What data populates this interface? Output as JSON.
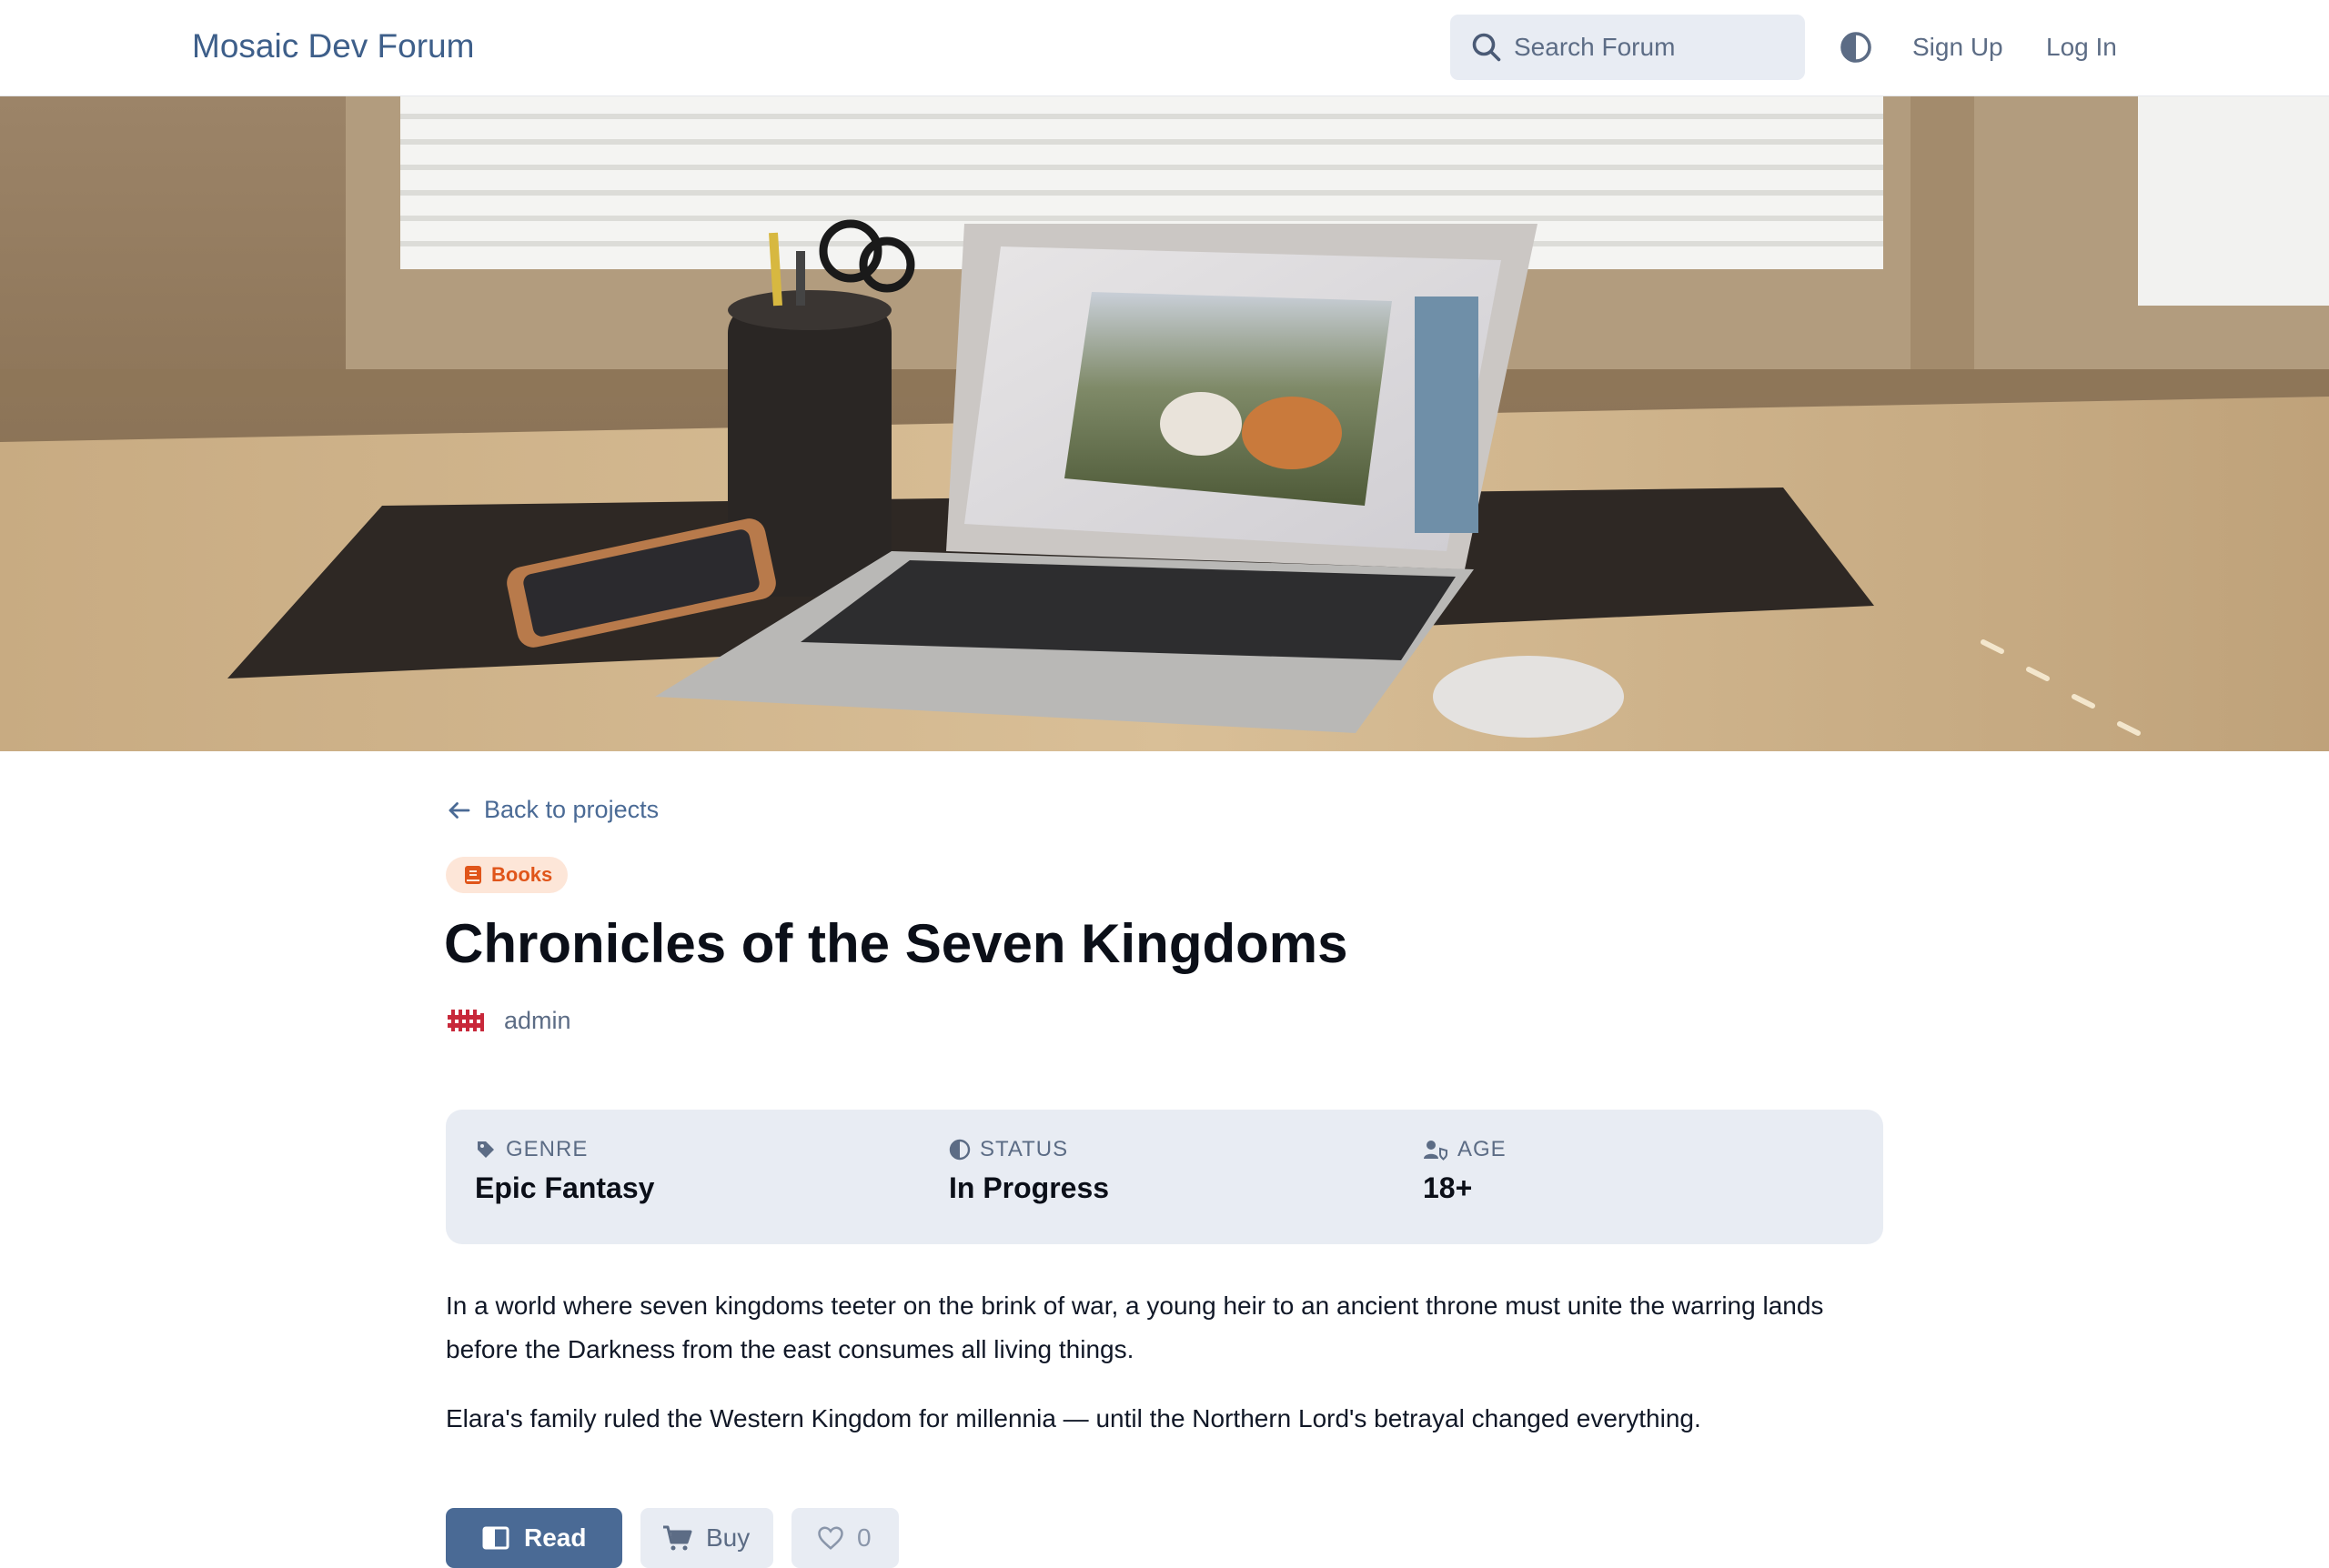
{
  "header": {
    "brand": "Mosaic Dev Forum",
    "search_placeholder": "Search Forum",
    "signup_label": "Sign Up",
    "login_label": "Log In"
  },
  "page": {
    "back_label": "Back to projects",
    "category_badge": "Books",
    "title": "Chronicles of the Seven Kingdoms",
    "author": "admin"
  },
  "info": {
    "genre_label": "GENRE",
    "genre_value": "Epic Fantasy",
    "status_label": "STATUS",
    "status_value": "In Progress",
    "age_label": "AGE",
    "age_value": "18+"
  },
  "description": {
    "paragraph_1": "In a world where seven kingdoms teeter on the brink of war, a young heir to an ancient throne must unite the warring lands before the Darkness from the east consumes all living things.",
    "paragraph_2": "Elara's family ruled the Western Kingdom for millennia — until the Northern Lord's betrayal changed everything."
  },
  "actions": {
    "read_label": "Read",
    "buy_label": "Buy",
    "like_count": "0"
  },
  "colors": {
    "brand": "#3e5f8a",
    "primary_button": "#4a6a95",
    "badge_bg": "#fde6d8",
    "badge_text": "#e0551a",
    "card_bg": "#e8ecf3"
  },
  "icons": {
    "search": "search-icon",
    "theme": "contrast-icon",
    "back": "arrow-left-icon",
    "badge": "book-icon",
    "genre": "tag-icon",
    "status": "contrast-icon",
    "age": "user-shield-icon",
    "read": "book-open-icon",
    "buy": "cart-icon",
    "like": "heart-icon"
  }
}
